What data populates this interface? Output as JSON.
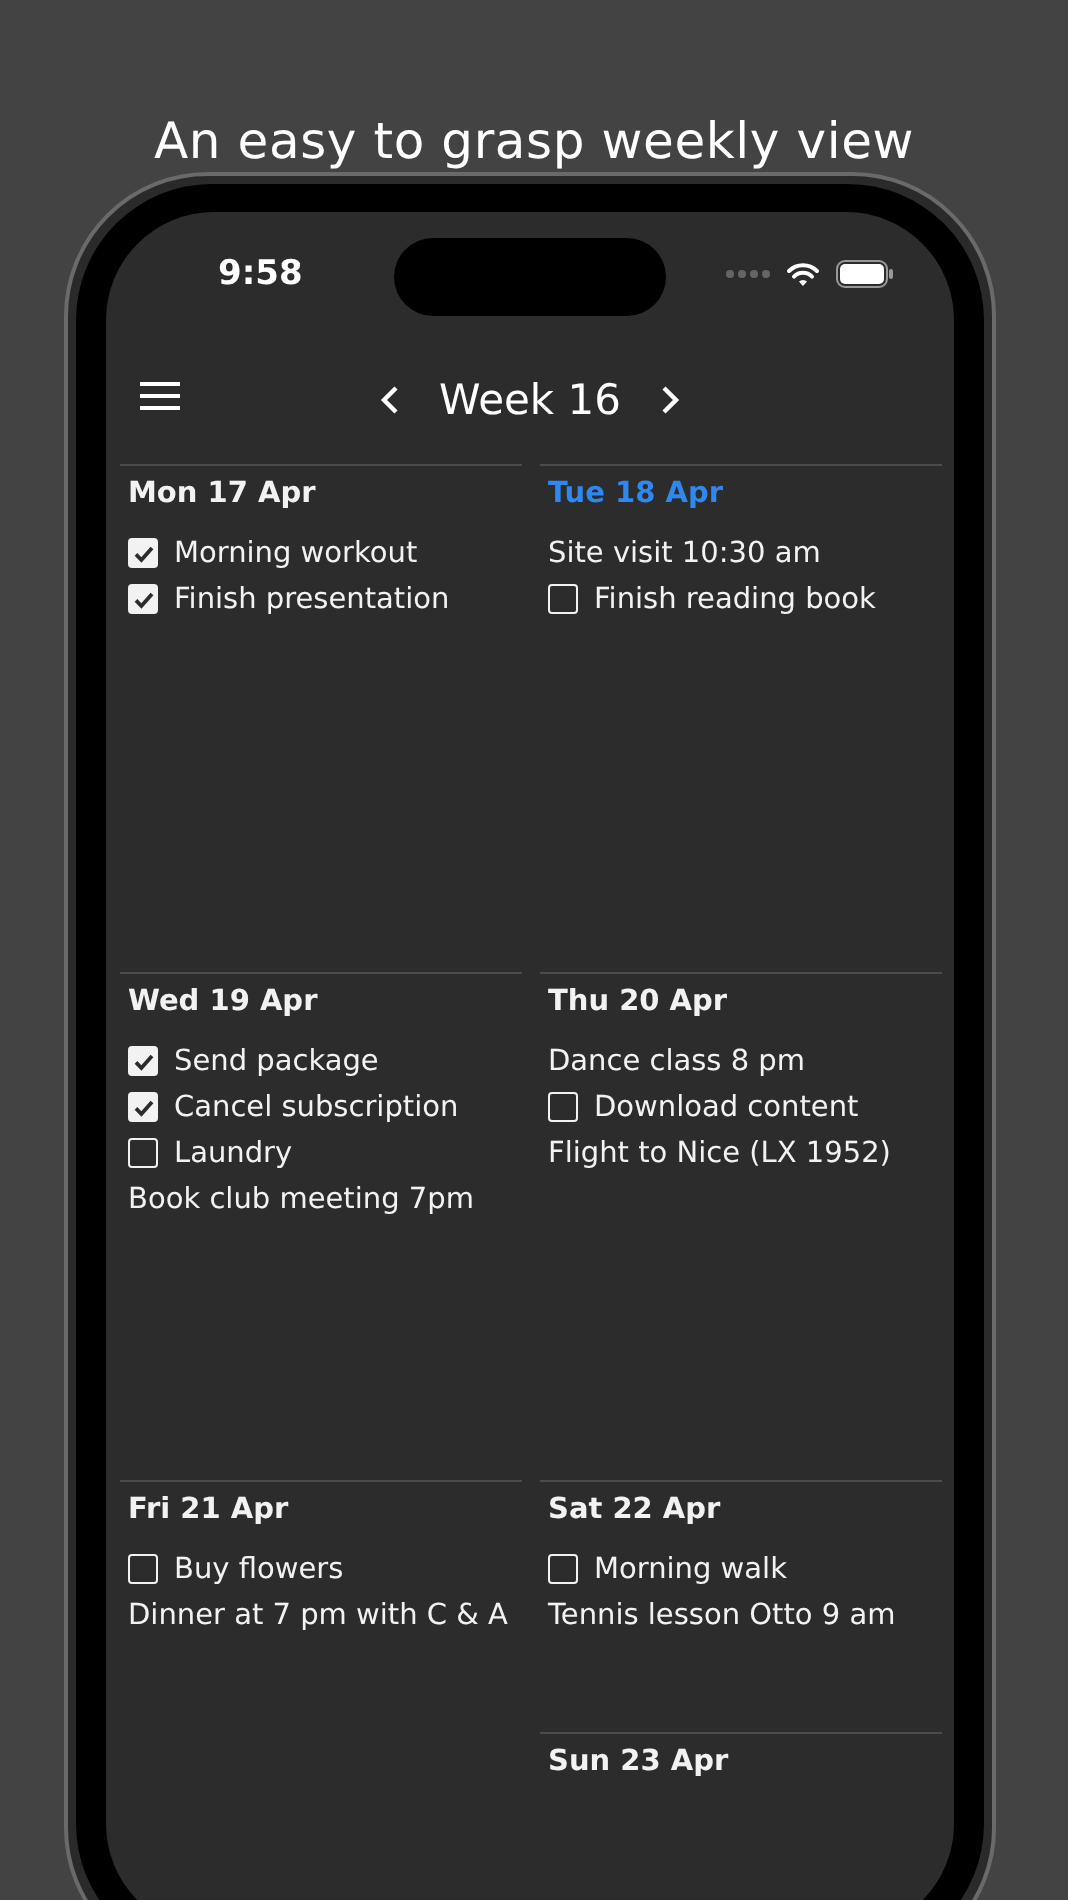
{
  "headline": "An easy to grasp weekly view",
  "status_bar": {
    "time": "9:58"
  },
  "header": {
    "title": "Week 16"
  },
  "days": [
    {
      "title": "Mon 17 Apr",
      "today": false,
      "items": [
        {
          "kind": "task",
          "text": "Morning workout",
          "checked": true
        },
        {
          "kind": "task",
          "text": "Finish presentation",
          "checked": true
        }
      ]
    },
    {
      "title": "Tue 18 Apr",
      "today": true,
      "items": [
        {
          "kind": "event",
          "text": "Site visit 10:30 am"
        },
        {
          "kind": "task",
          "text": "Finish reading book",
          "checked": false
        }
      ]
    },
    {
      "title": "Wed 19 Apr",
      "today": false,
      "items": [
        {
          "kind": "task",
          "text": "Send package",
          "checked": true
        },
        {
          "kind": "task",
          "text": "Cancel subscription",
          "checked": true
        },
        {
          "kind": "task",
          "text": "Laundry",
          "checked": false
        },
        {
          "kind": "event",
          "text": "Book club meeting 7pm"
        }
      ]
    },
    {
      "title": "Thu 20 Apr",
      "today": false,
      "items": [
        {
          "kind": "event",
          "text": "Dance class 8 pm"
        },
        {
          "kind": "task",
          "text": "Download content",
          "checked": false
        },
        {
          "kind": "event",
          "text": "Flight to Nice (LX 1952)"
        }
      ]
    },
    {
      "title": "Fri 21 Apr",
      "today": false,
      "items": [
        {
          "kind": "task",
          "text": "Buy flowers",
          "checked": false
        },
        {
          "kind": "event",
          "text": "Dinner at 7 pm with C & A"
        }
      ]
    },
    {
      "title": "Sat 22 Apr",
      "today": false,
      "items": [
        {
          "kind": "task",
          "text": "Morning walk",
          "checked": false
        },
        {
          "kind": "event",
          "text": "Tennis lesson Otto 9 am"
        }
      ]
    },
    {
      "title": "Sun 23 Apr",
      "today": false
    }
  ]
}
